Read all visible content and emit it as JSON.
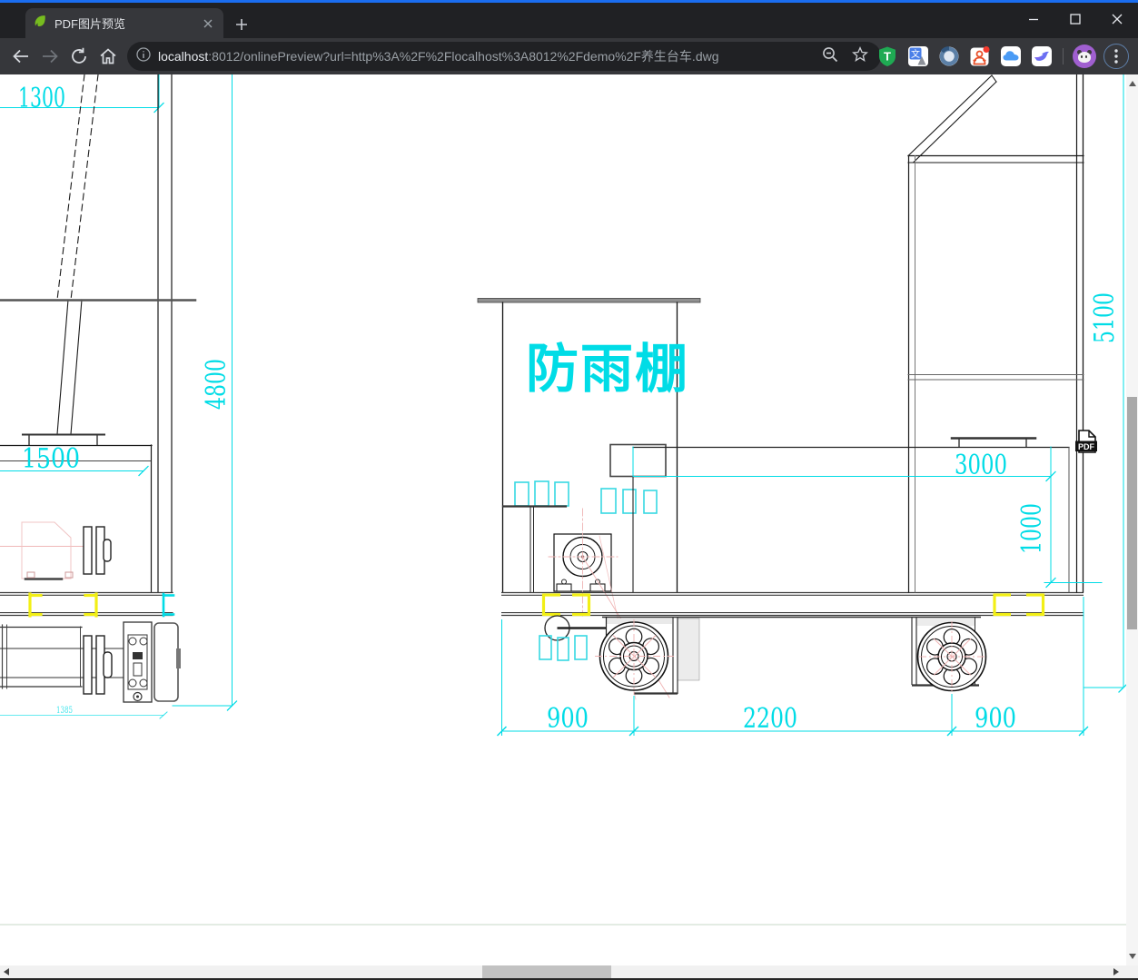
{
  "window": {
    "tab_title": "PDF图片预览"
  },
  "urlbar": {
    "host": "localhost",
    "rest": ":8012/onlinePreview?url=http%3A%2F%2Flocalhost%3A8012%2Fdemo%2F养生台车.dwg"
  },
  "icons": {
    "favicon": "spring-leaf",
    "tampermonkey_glyph": "T",
    "translate_glyph": "文"
  },
  "drawing": {
    "shed_label": "防雨棚",
    "pdf_badge": "PDF",
    "dims": {
      "top_left": "1300",
      "height_left": "4800",
      "inner_left": "1500",
      "axle": "1385",
      "front_left": "900",
      "middle": "2200",
      "front_right": "900",
      "deck_width": "3000",
      "deck_height": "1000",
      "height_right": "5100"
    },
    "colors": {
      "dimension": "#00dce6",
      "bracket_yellow": "#f2ef15",
      "centerline_pink": "#efb2b2"
    }
  }
}
